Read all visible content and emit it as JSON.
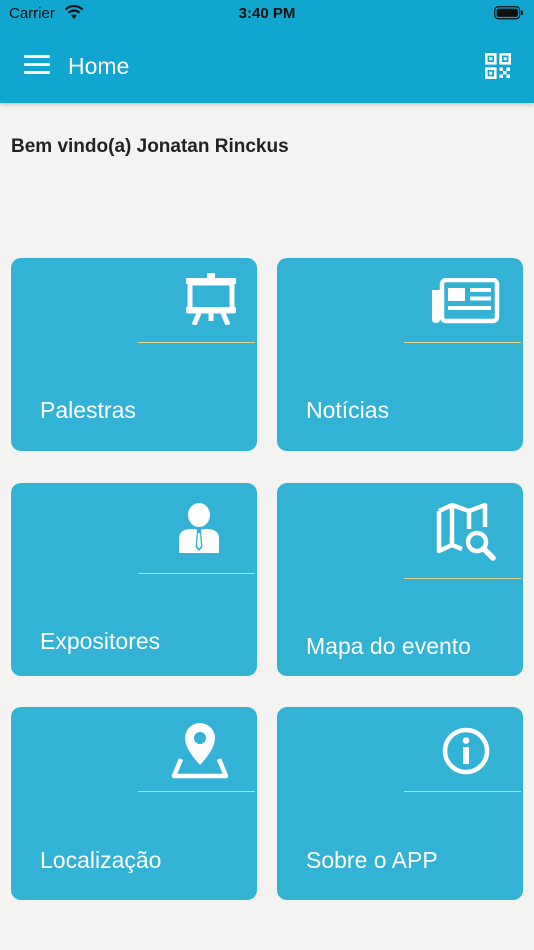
{
  "status_bar": {
    "carrier": "Carrier",
    "time": "3:40 PM"
  },
  "header": {
    "title": "Home",
    "menu_icon": "hamburger-menu-icon",
    "action_icon": "qr-code-icon",
    "background_color": "#11a6cf"
  },
  "welcome": {
    "text": "Bem vindo(a) Jonatan Rinckus"
  },
  "tiles": [
    {
      "label": "Palestras",
      "icon": "presentation-board-icon"
    },
    {
      "label": "Notícias",
      "icon": "newspaper-icon"
    },
    {
      "label": "Expositores",
      "icon": "person-suit-icon"
    },
    {
      "label": "Mapa do evento",
      "icon": "map-search-icon"
    },
    {
      "label": "Localização",
      "icon": "location-pin-icon"
    },
    {
      "label": "Sobre o APP",
      "icon": "info-icon"
    }
  ],
  "colors": {
    "tile": "#32b2d5",
    "divider": "#e3d889",
    "background": "#f3f4f2"
  }
}
